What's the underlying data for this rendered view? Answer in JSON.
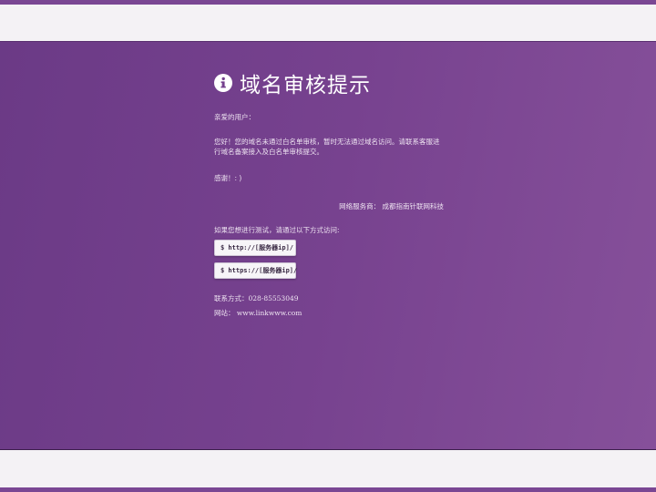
{
  "page": {
    "title": "域名审核提示",
    "icon": "info-circle-icon",
    "greeting": "亲爱的用户：",
    "message": "您好！您的域名未通过白名单审核，暂时无法通过域名访问。请联系客服进行域名备案接入及白名单审核提交。",
    "thanks": "感谢！: )",
    "provider": "网络服务商： 成都指南针联网科技",
    "test_intro": "如果您想进行测试，请通过以下方式访问:",
    "commands": [
      {
        "label": "$ http://[服务器ip]/"
      },
      {
        "label": "$ https://[服务器ip]/"
      }
    ],
    "contact_label": "联系方式：",
    "contact_value": "028-85553049",
    "website_label": "网站：",
    "website_value": "www.linkwww.com"
  },
  "colors": {
    "panel_start": "#6b3a86",
    "panel_end": "#86509a",
    "band": "#f4f2f5",
    "strip": "#7a4793",
    "text": "#eee3f1",
    "title": "#ffffff"
  }
}
